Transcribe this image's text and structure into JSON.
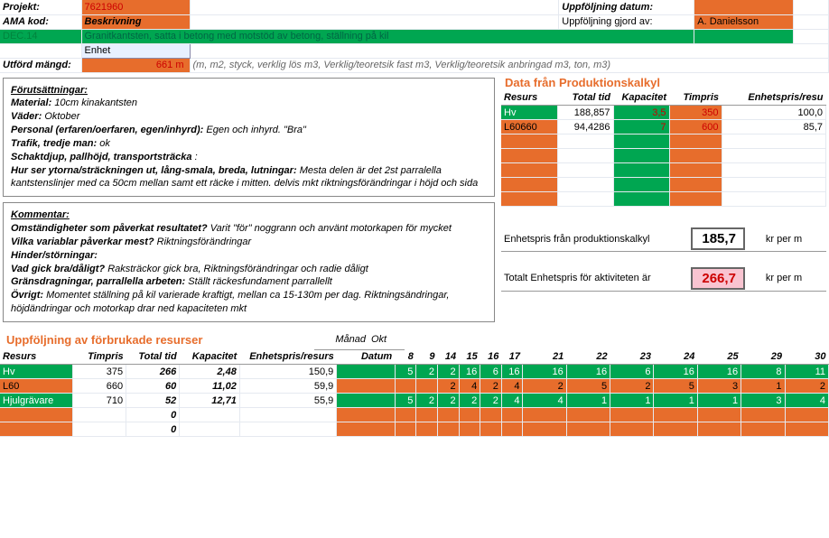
{
  "header": {
    "projekt_label": "Projekt:",
    "projekt_val": "7621960",
    "ama_label": "AMA kod:",
    "ama_val": "Beskrivning",
    "code": "DEC.14",
    "code_desc": "Granitkantsten, satta i betong med motstöd av betong, ställning på kil",
    "enhet_label": "Enhet",
    "utf_label": "Utförd mängd:",
    "utf_val": "661",
    "utf_unit": "m",
    "utf_note": "(m, m2, styck, verklig lös m3, Verklig/teoretsik fast m3, Verklig/teoretsik anbringad m3, ton, m3)",
    "upp_datum_label": "Uppföljning datum:",
    "upp_av_label": "Uppföljning gjord av:",
    "upp_av_val": "A. Danielsson"
  },
  "forut": {
    "title": "Förutsättningar:",
    "material_l": "Material:",
    "material_v": "10cm kinakantsten",
    "vader_l": "Väder:",
    "vader_v": "Oktober",
    "personal_l": "Personal (erfaren/oerfaren, egen/inhyrd):",
    "personal_v": "Egen och inhyrd. \"Bra\"",
    "trafik_l": "Trafik, tredje man:",
    "trafik_v": "ok",
    "schakt_l": "Schaktdjup, pallhöjd, transportsträcka",
    "schakt_v": ":",
    "ytor_l": "Hur ser ytorna/sträckningen ut, lång-smala, breda, lutningar:",
    "ytor_v": "Mesta delen är det 2st parralella kantstenslinjer med ca 50cm mellan samt ett räcke i mitten. delvis mkt riktningsförändringar i höjd och sida"
  },
  "komm": {
    "title": "Kommentar:",
    "omst_l": "Omständigheter som påverkat resultatet?",
    "omst_v": "Varit \"för\" noggrann och använt motorkapen för mycket",
    "var_l": "Vilka variablar påverkar mest?",
    "var_v": "Riktningsförändringar",
    "hinder_l": "Hinder/störningar:",
    "hinder_v": "",
    "bra_l": "Vad gick bra/dåligt?",
    "bra_v": "Raksträckor gick bra, Riktningsförändringar och radie dåligt",
    "grans_l": "Gränsdragningar, parrallella arbeten:",
    "grans_v": "Ställt räckesfundament parrallellt",
    "ovr_l": "Övrigt:",
    "ovr_v": "Momentet ställning på kil varierade kraftigt, mellan ca 15-130m per dag. Riktningsändringar, höjdändringar och motorkap drar ned kapaciteten mkt"
  },
  "prodkalkyl": {
    "title": "Data från Produktionskalkyl",
    "h_resurs": "Resurs",
    "h_totaltid": "Total tid",
    "h_kapacitet": "Kapacitet",
    "h_timpris": "Timpris",
    "h_enhetspris": "Enhetspris/resu",
    "rows": [
      {
        "resurs": "Hv",
        "totaltid": "188,857",
        "kapacitet": "3,5",
        "timpris": "350",
        "enhet": "100,0",
        "cls": "green"
      },
      {
        "resurs": "L60660",
        "totaltid": "94,4286",
        "kapacitet": "7",
        "timpris": "600",
        "enhet": "85,7",
        "cls": "orange"
      }
    ],
    "blank_orange_rows": 5
  },
  "prices": {
    "prod_label": "Enhetspris från produktionskalkyl",
    "prod_val": "185,7",
    "prod_unit": "kr per m",
    "tot_label": "Totalt Enhetspris för aktiviteten är",
    "tot_val": "266,7",
    "tot_unit": "kr per m"
  },
  "follow": {
    "title": "Uppföljning av förbrukade resurser",
    "manad_l": "Månad",
    "manad_v": "Okt",
    "datum_l": "Datum",
    "h_resurs": "Resurs",
    "h_timpris": "Timpris",
    "h_totaltid": "Total tid",
    "h_kapacitet": "Kapacitet",
    "h_enhet": "Enhetspris/resurs",
    "dates": [
      "8",
      "9",
      "14",
      "15",
      "16",
      "17",
      "21",
      "22",
      "23",
      "24",
      "25",
      "29",
      "30"
    ],
    "rows": [
      {
        "resurs": "Hv",
        "cls": "green",
        "timpris": "375",
        "totaltid": "266",
        "kapacitet": "2,48",
        "enhet": "150,9",
        "vals": [
          "5",
          "2",
          "2",
          "16",
          "6",
          "16",
          "16",
          "16",
          "6",
          "16",
          "16",
          "8",
          "11"
        ]
      },
      {
        "resurs": "L60",
        "cls": "orange",
        "timpris": "660",
        "totaltid": "60",
        "kapacitet": "11,02",
        "enhet": "59,9",
        "vals": [
          "",
          "",
          "2",
          "4",
          "2",
          "4",
          "2",
          "5",
          "2",
          "5",
          "3",
          "1",
          "2"
        ]
      },
      {
        "resurs": "Hjulgrävare",
        "cls": "green",
        "timpris": "710",
        "totaltid": "52",
        "kapacitet": "12,71",
        "enhet": "55,9",
        "vals": [
          "5",
          "2",
          "2",
          "2",
          "2",
          "4",
          "4",
          "1",
          "1",
          "1",
          "1",
          "3",
          "4"
        ]
      },
      {
        "resurs": "",
        "cls": "orange",
        "timpris": "",
        "totaltid": "0",
        "kapacitet": "",
        "enhet": "",
        "vals": [
          "",
          "",
          "",
          "",
          "",
          "",
          "",
          "",
          "",
          "",
          "",
          "",
          ""
        ]
      },
      {
        "resurs": "",
        "cls": "orange",
        "timpris": "",
        "totaltid": "0",
        "kapacitet": "",
        "enhet": "",
        "vals": [
          "",
          "",
          "",
          "",
          "",
          "",
          "",
          "",
          "",
          "",
          "",
          "",
          ""
        ]
      }
    ]
  }
}
